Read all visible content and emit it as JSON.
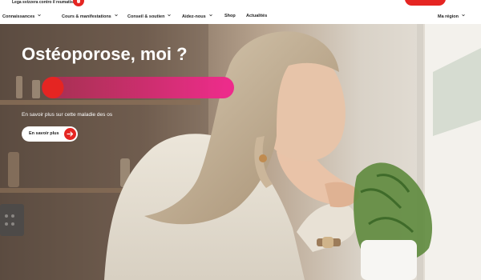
{
  "header": {
    "brand_text": "Lega svizzera contro il reumatismo",
    "brand_logo_icon": "heart-logo-icon",
    "accent": "#e52522"
  },
  "nav": {
    "items": [
      {
        "label": "Connaissances",
        "has_chevron": true
      },
      {
        "label": "Cours & manifestations",
        "has_chevron": true
      },
      {
        "label": "Conseil & soutien",
        "has_chevron": true
      },
      {
        "label": "Aidez-nous",
        "has_chevron": true
      },
      {
        "label": "Shop",
        "has_chevron": false
      },
      {
        "label": "Actualités",
        "has_chevron": false
      }
    ],
    "region_label": "Ma région"
  },
  "hero": {
    "title": "Ostéoporose, moi ?",
    "subtitle": "En savoir plus sur cette maladie des os",
    "button_label": "En savoir plus",
    "button_icon": "arrow-right-icon",
    "accent_bar_colors": [
      "#e52522",
      "#ee2a8c"
    ]
  }
}
